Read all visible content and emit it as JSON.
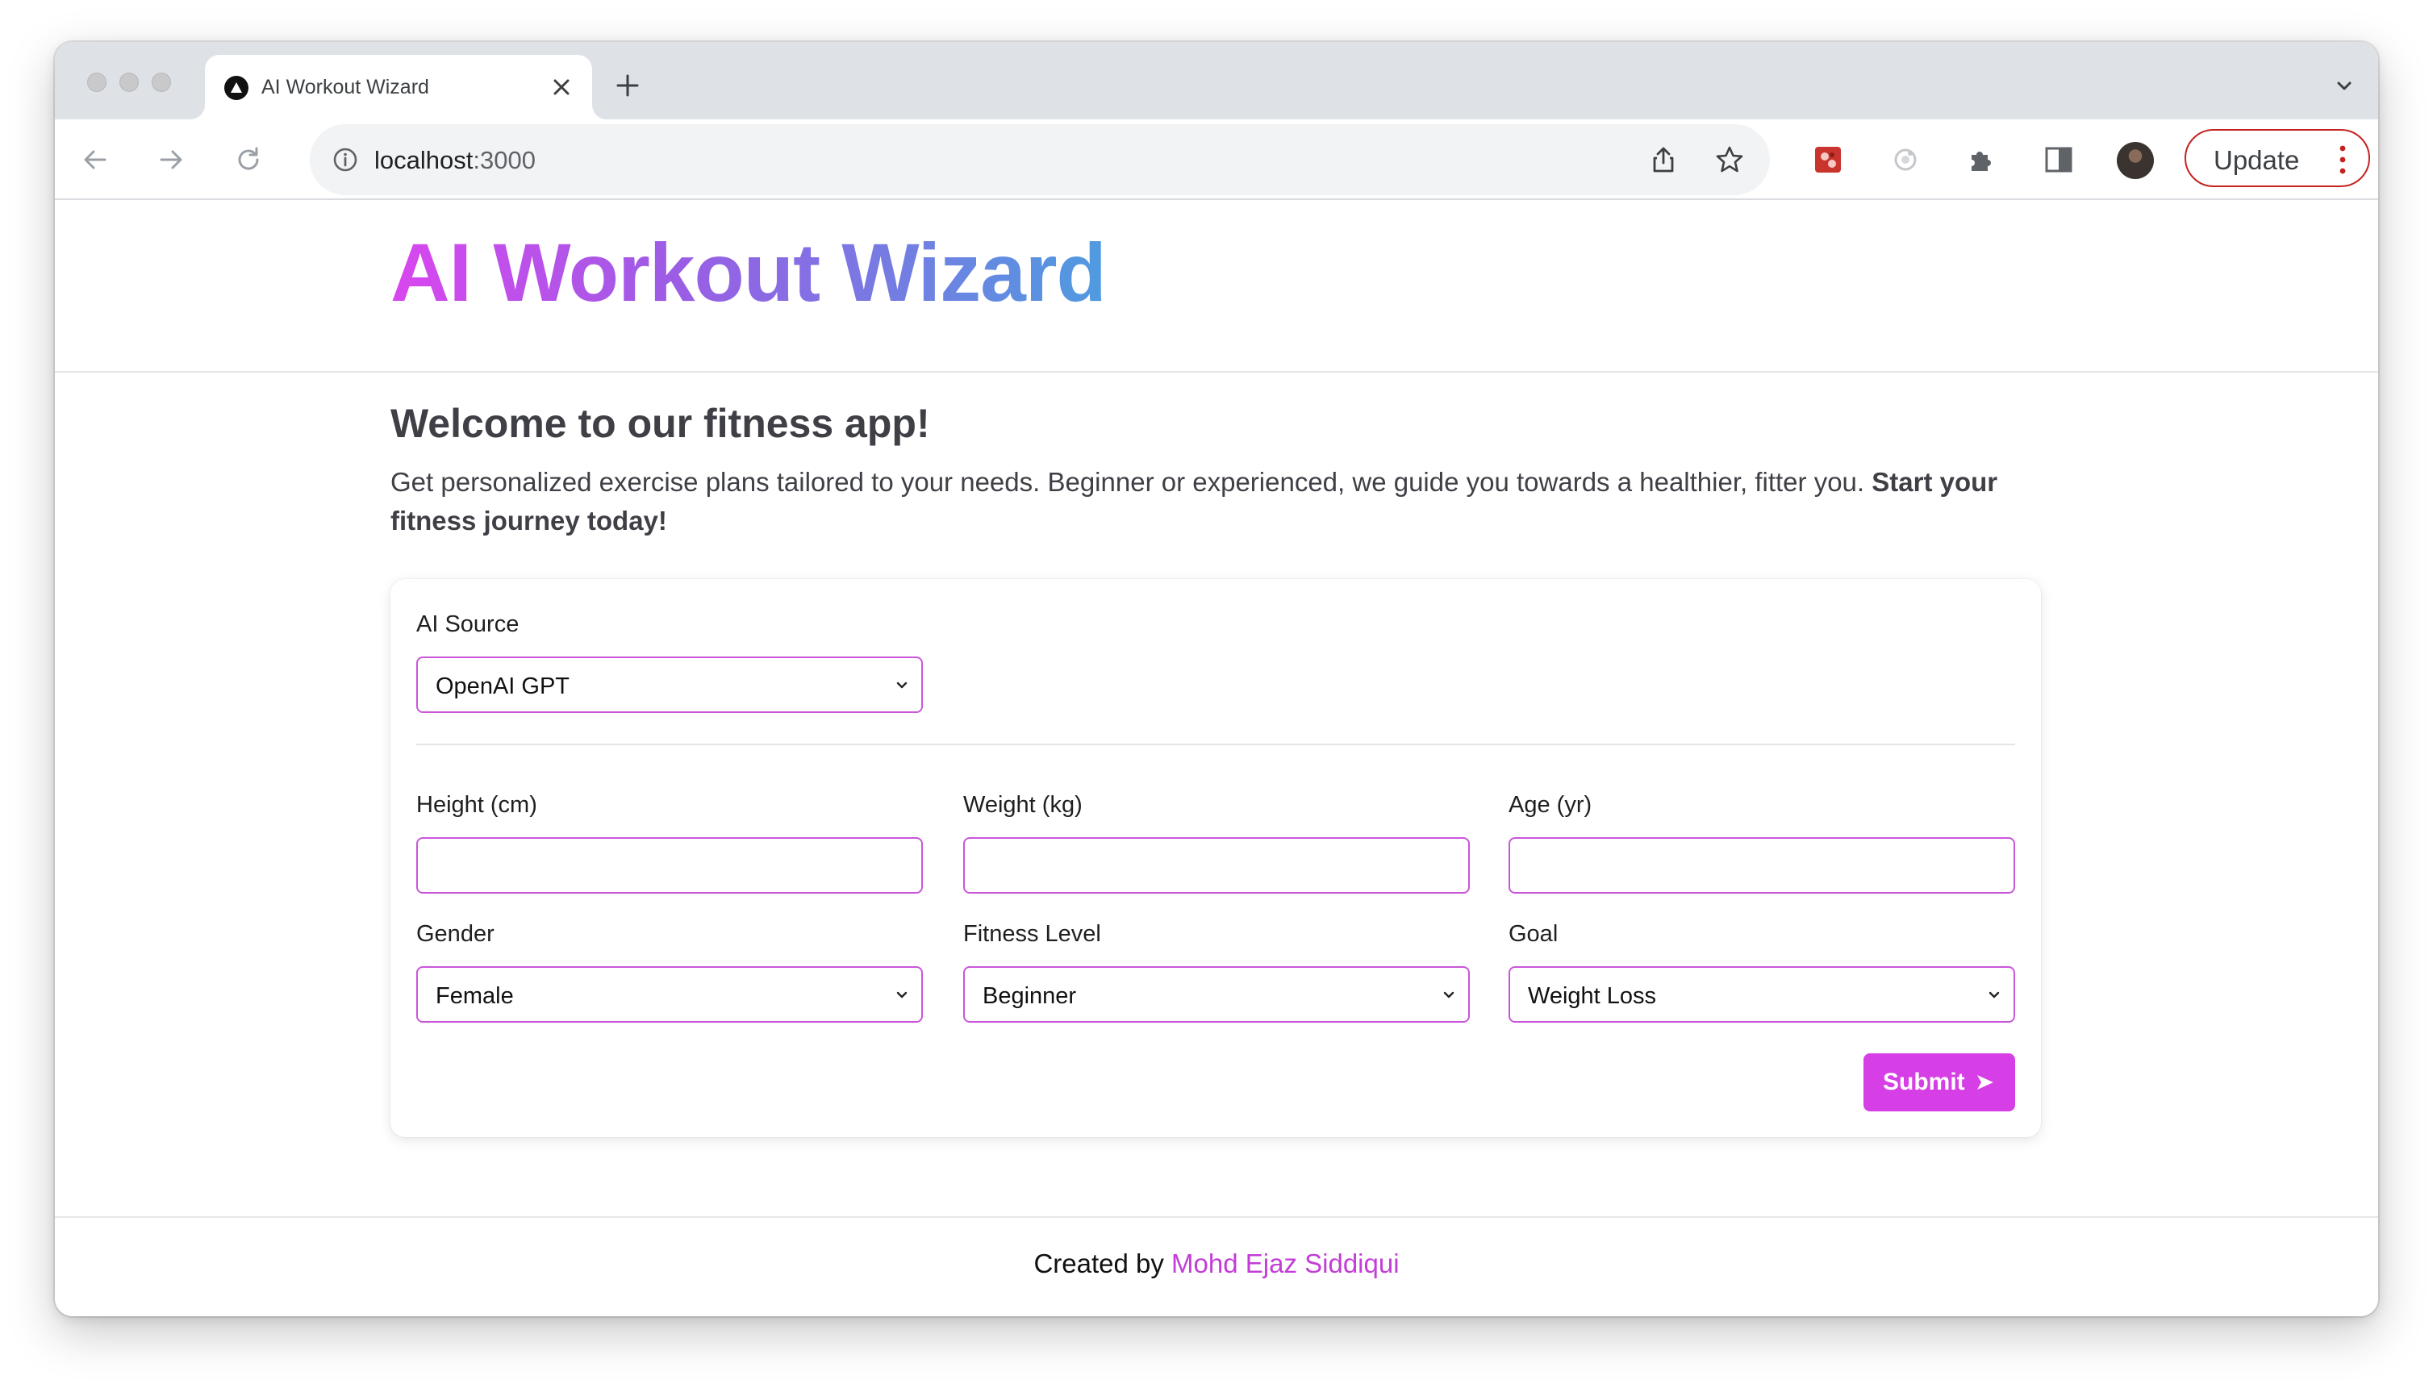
{
  "browser": {
    "tab": {
      "title": "AI Workout Wizard"
    },
    "address": {
      "host": "localhost",
      "port": ":3000"
    },
    "update_label": "Update"
  },
  "app": {
    "title": "AI Workout Wizard",
    "welcome_heading": "Welcome to our fitness app!",
    "intro_text": "Get personalized exercise plans tailored to your needs. Beginner or experienced, we guide you towards a healthier, fitter you. ",
    "intro_bold": "Start your fitness journey today!",
    "title_gradient": [
      "#d946ef",
      "#9b5de5",
      "#4f9be0"
    ],
    "accent_color": "#d63ee6"
  },
  "form": {
    "ai_source": {
      "label": "AI Source",
      "value": "OpenAI GPT"
    },
    "height": {
      "label": "Height (cm)",
      "value": ""
    },
    "weight": {
      "label": "Weight (kg)",
      "value": ""
    },
    "age": {
      "label": "Age (yr)",
      "value": ""
    },
    "gender": {
      "label": "Gender",
      "value": "Female"
    },
    "fitness_level": {
      "label": "Fitness Level",
      "value": "Beginner"
    },
    "goal": {
      "label": "Goal",
      "value": "Weight Loss"
    },
    "submit_label": "Submit"
  },
  "footer": {
    "prefix": "Created by ",
    "author": "Mohd Ejaz Siddiqui"
  }
}
